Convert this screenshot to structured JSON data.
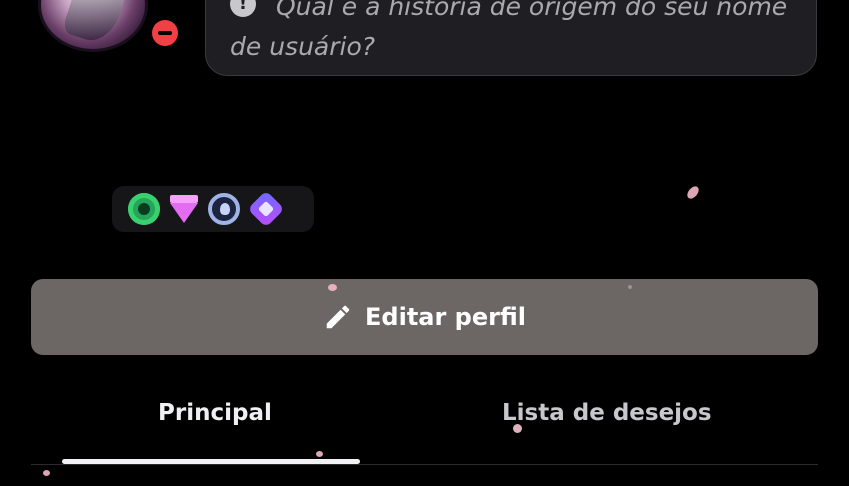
{
  "status_bubble": {
    "icon": "info-icon",
    "text": "Qual é a história de origem do seu nome de usuário?"
  },
  "avatar": {
    "status": "do-not-disturb",
    "status_color": "#f23f43"
  },
  "badges": [
    {
      "icon": "nitro-badge-icon"
    },
    {
      "icon": "gem-boost-badge-icon"
    },
    {
      "icon": "laurel-badge-icon"
    },
    {
      "icon": "quest-badge-icon"
    }
  ],
  "edit_profile": {
    "label": "Editar perfil",
    "icon": "pencil-icon"
  },
  "tabs": [
    {
      "label": "Principal",
      "active": true
    },
    {
      "label": "Lista de desejos",
      "active": false
    }
  ],
  "colors": {
    "background": "#000000",
    "button": "#6c6664",
    "bubble": "#1f1f23"
  }
}
